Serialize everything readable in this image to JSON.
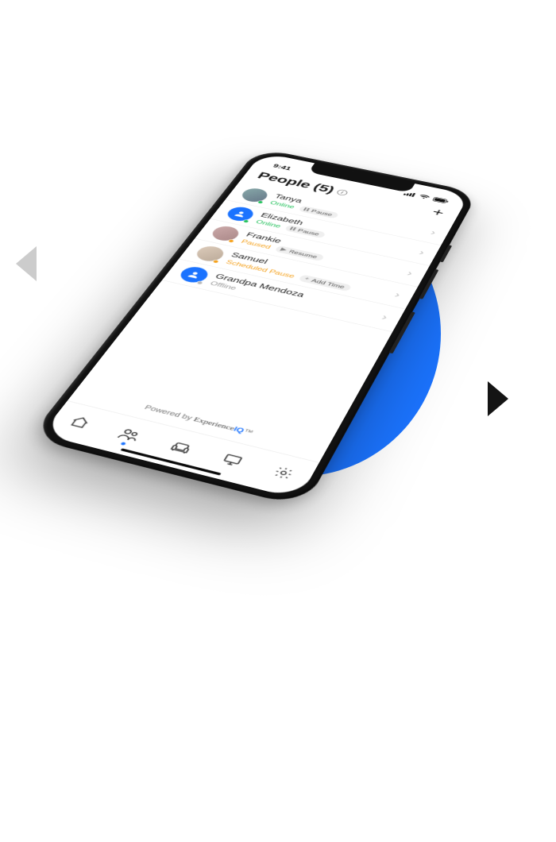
{
  "statusbar": {
    "time": "9:41"
  },
  "header": {
    "title": "People (5)",
    "info_tooltip": "i",
    "add_label": "+"
  },
  "people": [
    {
      "name": "Tanya",
      "status_text": "Online",
      "status_kind": "online",
      "avatar_kind": "photo",
      "action_label": "Pause",
      "action_icon": "pause"
    },
    {
      "name": "Elizabeth",
      "status_text": "Online",
      "status_kind": "online",
      "avatar_kind": "icon",
      "action_label": "Pause",
      "action_icon": "pause"
    },
    {
      "name": "Frankie",
      "status_text": "Paused",
      "status_kind": "paused",
      "avatar_kind": "photo",
      "action_label": "Resume",
      "action_icon": "play"
    },
    {
      "name": "Samuel",
      "status_text": "Scheduled Pause",
      "status_kind": "paused",
      "avatar_kind": "photo",
      "action_label": "Add Time",
      "action_icon": "plus"
    },
    {
      "name": "Grandpa Mendoza",
      "status_text": "Offline",
      "status_kind": "offline",
      "avatar_kind": "icon",
      "action_label": "",
      "action_icon": ""
    }
  ],
  "footer": {
    "prefix": "Powered by ",
    "brand": "Experience",
    "suffix": "IQ",
    "tm": "™"
  },
  "tabs": {
    "home": "home-icon",
    "people": "people-icon",
    "places": "sofa-icon",
    "things": "monitor-icon",
    "settings": "gear-icon",
    "active": "people"
  },
  "colors": {
    "accent": "#1a73ff",
    "online": "#21c15a",
    "paused": "#f5a11b",
    "offline": "#9a9a9a"
  }
}
